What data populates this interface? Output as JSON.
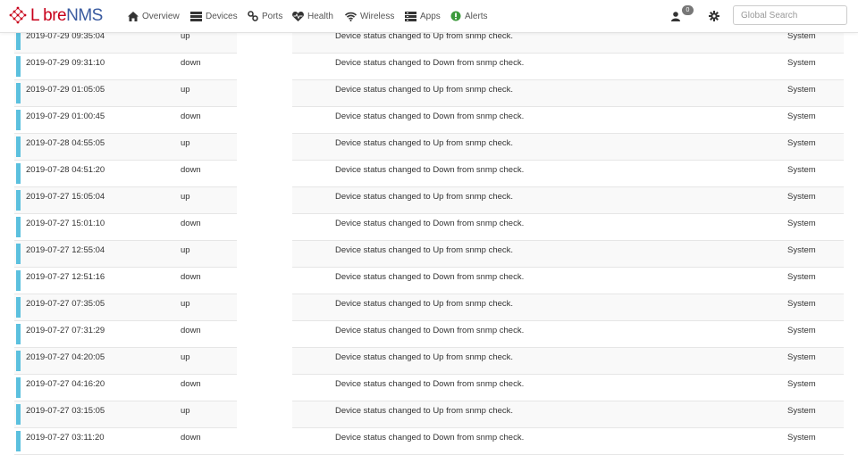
{
  "brand": {
    "prefix": "L",
    "middle": "bre",
    "suffix": "NMS"
  },
  "nav": {
    "overview": "Overview",
    "devices": "Devices",
    "ports": "Ports",
    "health": "Health",
    "wireless": "Wireless",
    "apps": "Apps",
    "alerts": "Alerts"
  },
  "user": {
    "notification_count": "0"
  },
  "search": {
    "placeholder": "Global Search"
  },
  "colors": {
    "status_bar": "#5bc0de",
    "brand_red": "#c8001b",
    "brand_blue": "#3a5ba0",
    "alerts_green": "#3c9a3c"
  },
  "events": [
    {
      "timestamp": "2019-07-29 09:35:04",
      "status": "up",
      "message": "Device status changed to Up from snmp check.",
      "user": "System"
    },
    {
      "timestamp": "2019-07-29 09:31:10",
      "status": "down",
      "message": "Device status changed to Down from snmp check.",
      "user": "System"
    },
    {
      "timestamp": "2019-07-29 01:05:05",
      "status": "up",
      "message": "Device status changed to Up from snmp check.",
      "user": "System"
    },
    {
      "timestamp": "2019-07-29 01:00:45",
      "status": "down",
      "message": "Device status changed to Down from snmp check.",
      "user": "System"
    },
    {
      "timestamp": "2019-07-28 04:55:05",
      "status": "up",
      "message": "Device status changed to Up from snmp check.",
      "user": "System"
    },
    {
      "timestamp": "2019-07-28 04:51:20",
      "status": "down",
      "message": "Device status changed to Down from snmp check.",
      "user": "System"
    },
    {
      "timestamp": "2019-07-27 15:05:04",
      "status": "up",
      "message": "Device status changed to Up from snmp check.",
      "user": "System"
    },
    {
      "timestamp": "2019-07-27 15:01:10",
      "status": "down",
      "message": "Device status changed to Down from snmp check.",
      "user": "System"
    },
    {
      "timestamp": "2019-07-27 12:55:04",
      "status": "up",
      "message": "Device status changed to Up from snmp check.",
      "user": "System"
    },
    {
      "timestamp": "2019-07-27 12:51:16",
      "status": "down",
      "message": "Device status changed to Down from snmp check.",
      "user": "System"
    },
    {
      "timestamp": "2019-07-27 07:35:05",
      "status": "up",
      "message": "Device status changed to Up from snmp check.",
      "user": "System"
    },
    {
      "timestamp": "2019-07-27 07:31:29",
      "status": "down",
      "message": "Device status changed to Down from snmp check.",
      "user": "System"
    },
    {
      "timestamp": "2019-07-27 04:20:05",
      "status": "up",
      "message": "Device status changed to Up from snmp check.",
      "user": "System"
    },
    {
      "timestamp": "2019-07-27 04:16:20",
      "status": "down",
      "message": "Device status changed to Down from snmp check.",
      "user": "System"
    },
    {
      "timestamp": "2019-07-27 03:15:05",
      "status": "up",
      "message": "Device status changed to Up from snmp check.",
      "user": "System"
    },
    {
      "timestamp": "2019-07-27 03:11:20",
      "status": "down",
      "message": "Device status changed to Down from snmp check.",
      "user": "System"
    }
  ]
}
